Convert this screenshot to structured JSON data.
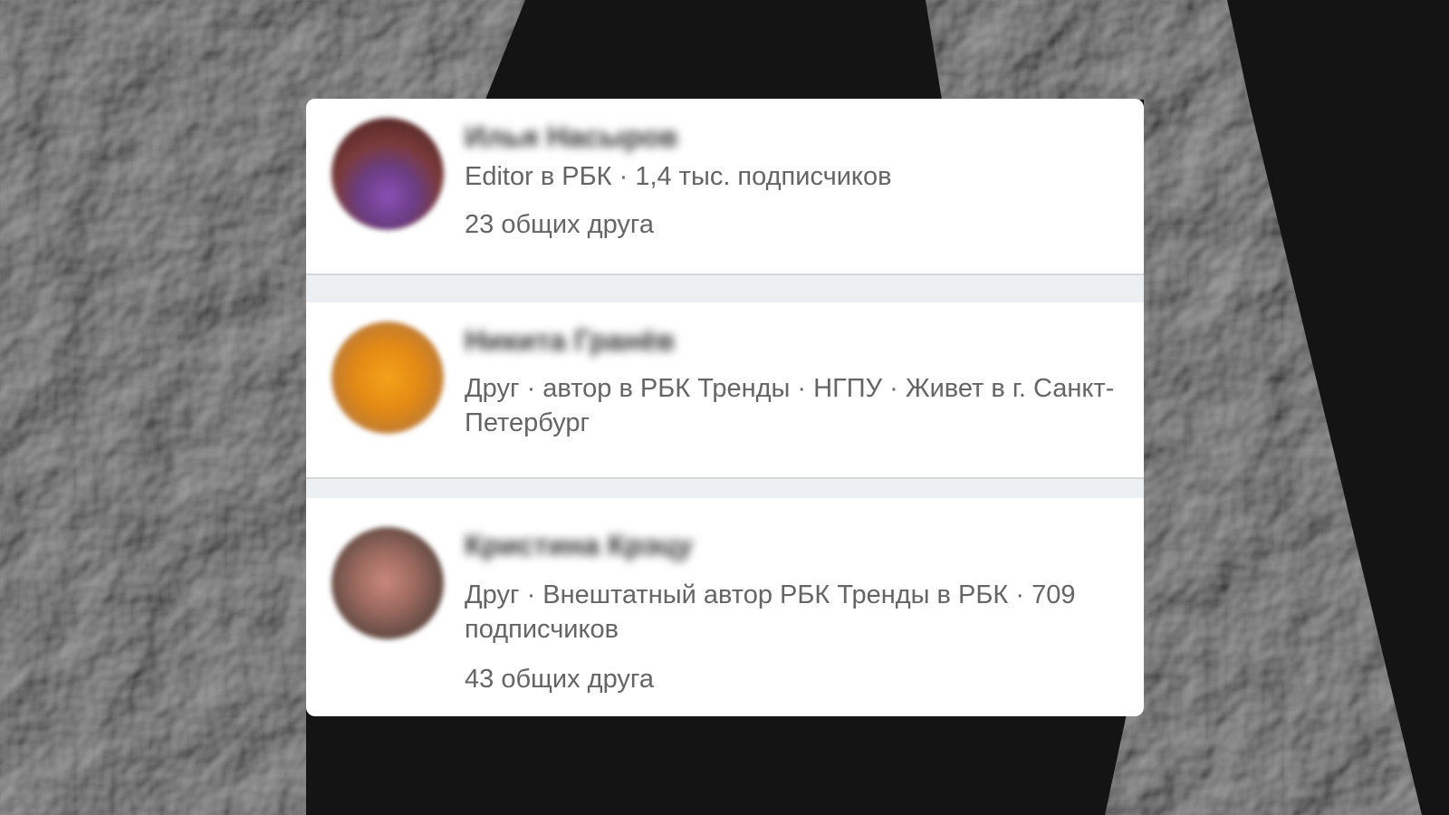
{
  "cards": [
    {
      "name": "Илья Насыров",
      "info": "Editor в РБК · 1,4 тыс. подписчиков",
      "mutual": "23 общих друга"
    },
    {
      "name": "Никита Гранёв",
      "info": "Друг · автор в РБК Тренды · НГПУ · Живет в г. Санкт-Петербург"
    },
    {
      "name": "Кристина Крэцу",
      "info": "Друг · Внештатный автор РБК Тренды в РБК · 709 подписчиков",
      "mutual": "43 общих друга"
    }
  ]
}
